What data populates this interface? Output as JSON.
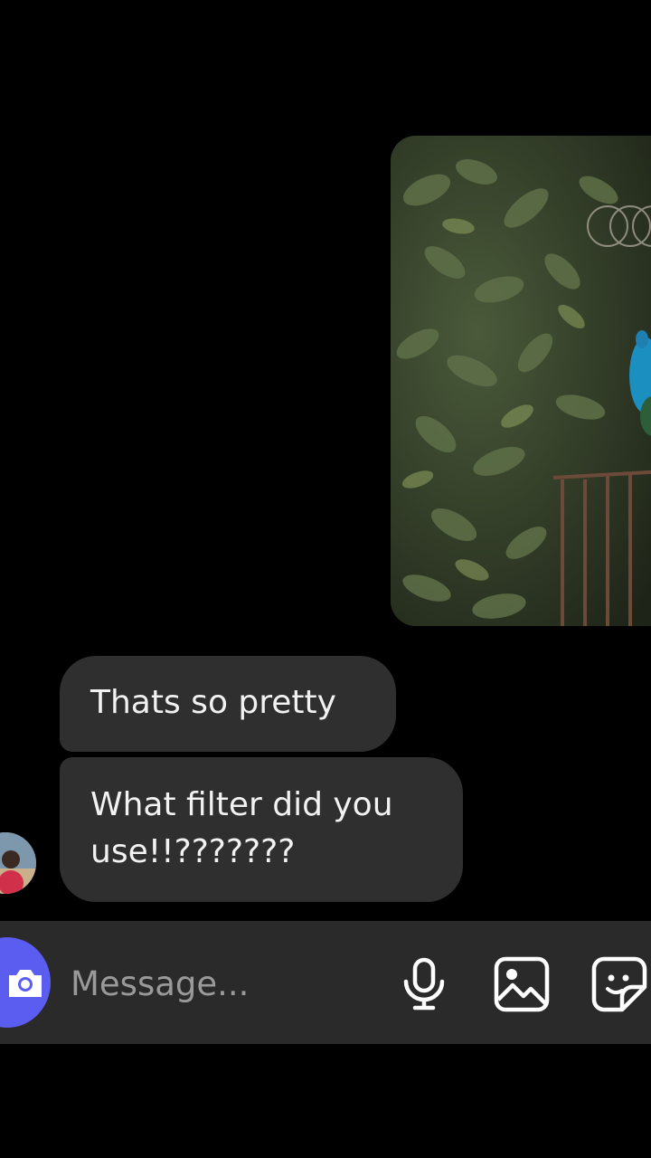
{
  "thread": {
    "shared_photo": {
      "icon": "peacock-photo"
    },
    "messages": [
      {
        "text": "Thats so pretty"
      },
      {
        "text": "What filter did you\nuse!!???????"
      }
    ],
    "sender_avatar": "avatar-photo"
  },
  "composer": {
    "placeholder": "Message...",
    "camera_icon": "camera-icon",
    "mic_icon": "microphone-icon",
    "gallery_icon": "image-icon",
    "sticker_icon": "sticker-icon",
    "accent": "#5b5cf0"
  },
  "colors": {
    "background": "#000000",
    "bubble": "#2f2f2f",
    "composer_bar": "#2a2a2a"
  }
}
